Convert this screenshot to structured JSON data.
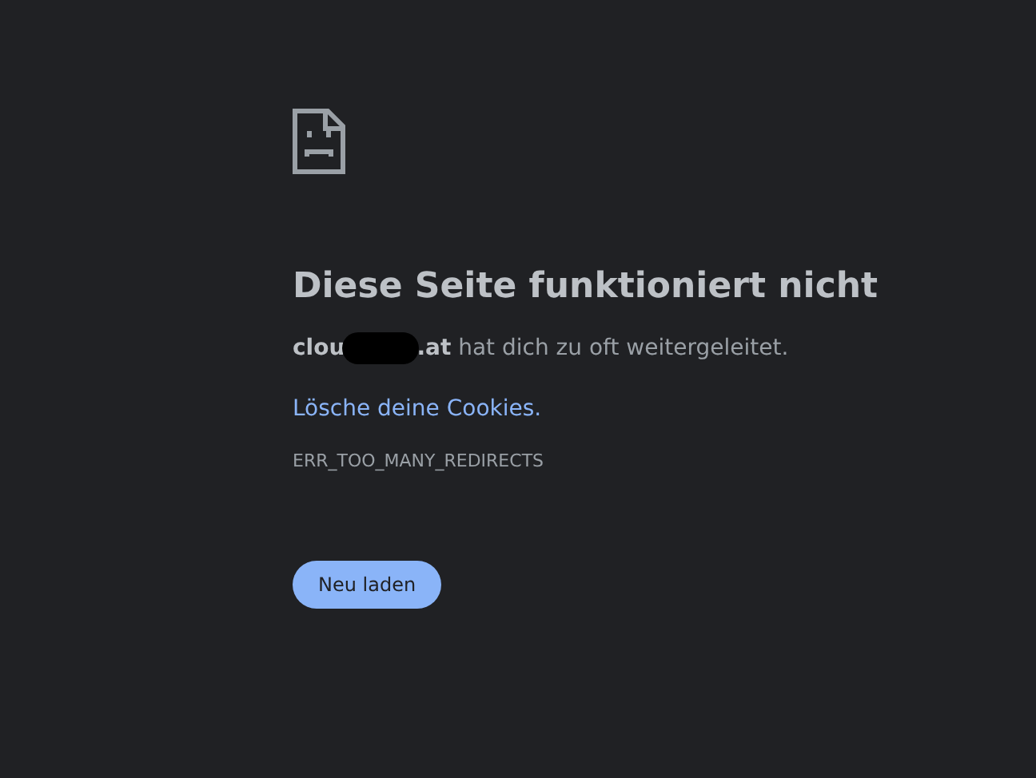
{
  "icon": {
    "kind": "sad-page"
  },
  "heading": "Diese Seite funktioniert nicht",
  "message": {
    "host_start": "clou",
    "redacted": true,
    "rest": "**.at** hat dich zu oft weitergeleitet."
  },
  "link": "Lösche deine Cookies.",
  "error_code": "ERR_TOO_MANY_REDIRECTS",
  "button": "Neu laden"
}
